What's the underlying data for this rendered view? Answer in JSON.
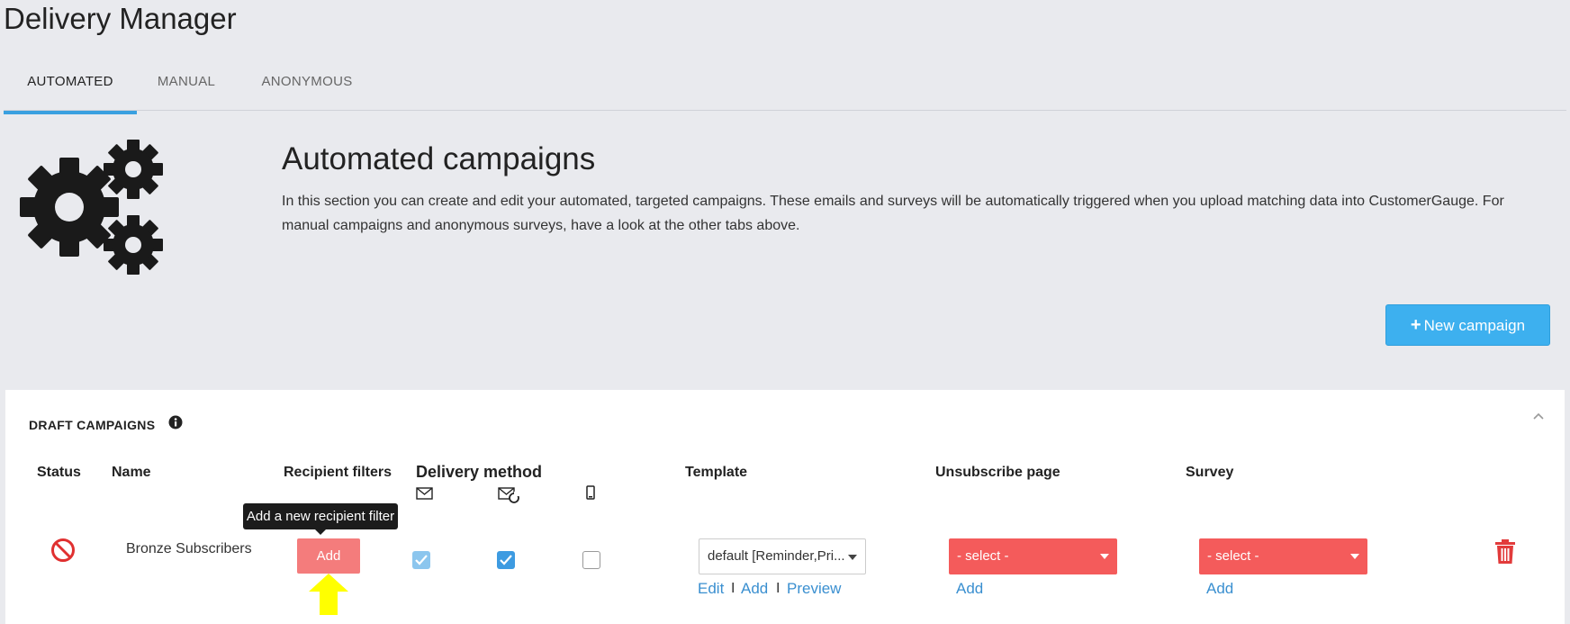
{
  "page": {
    "title": "Delivery Manager"
  },
  "tabs": [
    {
      "label": "AUTOMATED",
      "active": true
    },
    {
      "label": "MANUAL",
      "active": false
    },
    {
      "label": "ANONYMOUS",
      "active": false
    }
  ],
  "hero": {
    "icon": "gears-icon",
    "title": "Automated campaigns",
    "description": "In this section you can create and edit your automated, targeted campaigns. These emails and surveys will be automatically triggered when you upload matching data into CustomerGauge. For manual campaigns and anonymous surveys, have a look at the other tabs above."
  },
  "new_campaign_button": {
    "label": "New campaign",
    "icon": "plus-icon"
  },
  "draft_panel": {
    "title": "DRAFT CAMPAIGNS",
    "columns": {
      "status": "Status",
      "name": "Name",
      "recipient_filters": "Recipient filters",
      "delivery_method": "Delivery method",
      "template": "Template",
      "unsubscribe_page": "Unsubscribe page",
      "survey": "Survey"
    },
    "delivery_method_icons": [
      "envelope-icon",
      "envelope-repeat-icon",
      "mobile-phone-icon"
    ],
    "rows": [
      {
        "status_icon": "no-entry-icon",
        "name": "Bronze Subscribers",
        "recipient_filter_button": "Add",
        "tooltip": "Add a new recipient filter",
        "delivery": {
          "email": true,
          "reminder": true,
          "sms": false
        },
        "template": {
          "value": "default [Reminder,Pri...",
          "links": [
            "Edit",
            "Add",
            "Preview"
          ],
          "separator": "I"
        },
        "unsubscribe": {
          "value": "- select -",
          "link": "Add"
        },
        "survey": {
          "value": "- select -",
          "link": "Add"
        }
      }
    ]
  },
  "colors": {
    "accent": "#3db0ef",
    "danger": "#f45b5b",
    "add_button": "#f47c7c",
    "highlight_arrow": "#ffff00",
    "link": "#3a8fd0"
  }
}
